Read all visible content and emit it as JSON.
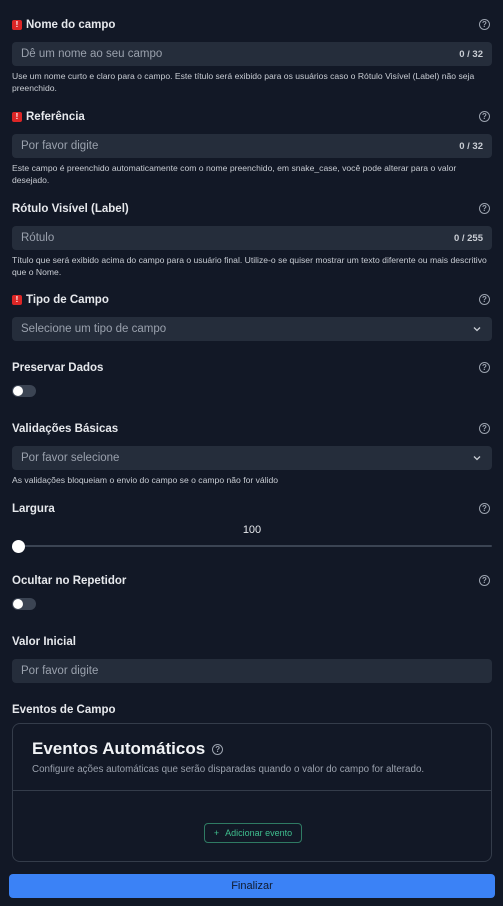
{
  "fields": {
    "name": {
      "label": "Nome do campo",
      "placeholder": "Dê um nome ao seu campo",
      "counter": "0 / 32",
      "hint": "Use um nome curto e claro para o campo. Este título será exibido para os usuários caso o Rótulo Visível (Label) não seja preenchido."
    },
    "reference": {
      "label": "Referência",
      "placeholder": "Por favor digite",
      "counter": "0 / 32",
      "hint": "Este campo é preenchido automaticamente com o nome preenchido, em snake_case, você pode alterar para o valor desejado."
    },
    "visible_label": {
      "label": "Rótulo Visível (Label)",
      "placeholder": "Rótulo",
      "counter": "0 / 255",
      "hint": "Título que será exibido acima do campo para o usuário final. Utilize-o se quiser mostrar um texto diferente ou mais descritivo que o Nome."
    },
    "field_type": {
      "label": "Tipo de Campo",
      "placeholder": "Selecione um tipo de campo"
    },
    "preserve_data": {
      "label": "Preservar Dados",
      "enabled": false
    },
    "basic_validations": {
      "label": "Validações Básicas",
      "placeholder": "Por favor selecione",
      "hint": "As validações bloqueiam o envio do campo se o campo não for válido"
    },
    "width": {
      "label": "Largura",
      "value": "100",
      "fraction": 0.0
    },
    "hide_in_repeater": {
      "label": "Ocultar no Repetidor",
      "enabled": false
    },
    "initial_value": {
      "label": "Valor Inicial",
      "placeholder": "Por favor digite"
    }
  },
  "events": {
    "section_label": "Eventos de Campo",
    "title": "Eventos Automáticos",
    "description": "Configure ações automáticas que serão disparadas quando o valor do campo for alterado.",
    "add_button": "Adicionar evento"
  },
  "actions": {
    "finalize": "Finalizar"
  },
  "icons": {
    "required": "exclamation-icon",
    "help": "question-circle-icon",
    "dropdown": "chevron-down-icon",
    "add": "plus-icon"
  },
  "colors": {
    "background": "#121826",
    "input": "#252d3b",
    "required": "#dc2626",
    "primary": "#3b82f6",
    "accent": "#3fbf8f"
  }
}
